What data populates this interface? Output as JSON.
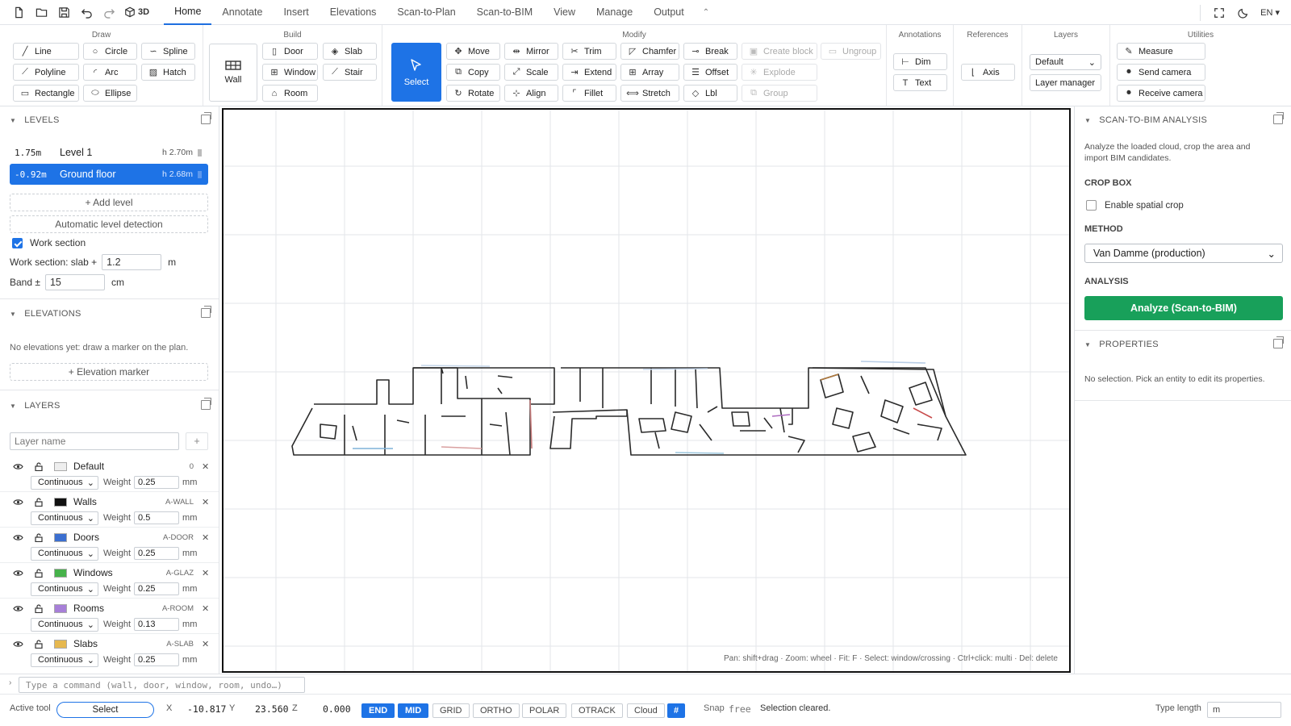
{
  "toolbar": {
    "three_d_label": "3D",
    "tabs": [
      "Home",
      "Annotate",
      "Insert",
      "Elevations",
      "Scan-to-Plan",
      "Scan-to-BIM",
      "View",
      "Manage",
      "Output"
    ],
    "active_tab": "Home",
    "lang": "EN"
  },
  "ribbon": {
    "draw": {
      "title": "Draw",
      "items": [
        "Line",
        "Circle",
        "Spline",
        "Polyline",
        "Arc",
        "Hatch",
        "Rectangle",
        "Ellipse"
      ]
    },
    "build": {
      "title": "Build",
      "wall": "Wall",
      "items": [
        "Door",
        "Slab",
        "Window",
        "Stair",
        "Room"
      ]
    },
    "modify": {
      "title": "Modify",
      "select": "Select",
      "items": [
        "Move",
        "Mirror",
        "Trim",
        "Chamfer",
        "Break",
        "Create block",
        "Ungroup",
        "Copy",
        "Scale",
        "Extend",
        "Array",
        "Offset",
        "Explode",
        "Rotate",
        "Align",
        "Fillet",
        "Stretch",
        "Lbl",
        "Group"
      ]
    },
    "annotations": {
      "title": "Annotations",
      "items": [
        "Dim",
        "Text"
      ]
    },
    "references": {
      "title": "References",
      "items": [
        "Axis"
      ]
    },
    "layers": {
      "title": "Layers",
      "current": "Default",
      "manager": "Layer manager"
    },
    "utilities": {
      "title": "Utilities",
      "items": [
        "Measure",
        "Send camera",
        "Receive camera"
      ]
    }
  },
  "levels": {
    "title": "LEVELS",
    "items": [
      {
        "elev": "1.75m",
        "name": "Level 1",
        "h": "h 2.70m"
      },
      {
        "elev": "-0.92m",
        "name": "Ground floor",
        "h": "h 2.68m"
      }
    ],
    "add": "+ Add level",
    "auto": "Automatic level detection",
    "work_section_label": "Work section",
    "slab_label": "Work section: slab +",
    "slab_value": "1.2",
    "slab_unit": "m",
    "band_label": "Band ±",
    "band_value": "15",
    "band_unit": "cm"
  },
  "elevations": {
    "title": "ELEVATIONS",
    "empty": "No elevations yet: draw a marker on the plan.",
    "add": "+ Elevation marker"
  },
  "layers": {
    "title": "LAYERS",
    "placeholder": "Layer name",
    "add": "+",
    "weight_label": "Weight",
    "unit": "mm",
    "items": [
      {
        "name": "Default",
        "code": "0",
        "type": "Continuous",
        "weight": "0.25",
        "color": "#eeeeee"
      },
      {
        "name": "Walls",
        "code": "A-WALL",
        "type": "Continuous",
        "weight": "0.5",
        "color": "#111111"
      },
      {
        "name": "Doors",
        "code": "A-DOOR",
        "type": "Continuous",
        "weight": "0.25",
        "color": "#3b6fd0"
      },
      {
        "name": "Windows",
        "code": "A-GLAZ",
        "type": "Continuous",
        "weight": "0.25",
        "color": "#46b24a"
      },
      {
        "name": "Rooms",
        "code": "A-ROOM",
        "type": "Continuous",
        "weight": "0.13",
        "color": "#a77fd8"
      },
      {
        "name": "Slabs",
        "code": "A-SLAB",
        "type": "Continuous",
        "weight": "0.25",
        "color": "#e6b84f"
      }
    ]
  },
  "canvas": {
    "hint": "Pan: shift+drag · Zoom: wheel · Fit: F · Select: window/crossing · Ctrl+click: multi · Del: delete"
  },
  "scan": {
    "title": "SCAN-TO-BIM ANALYSIS",
    "desc": "Analyze the loaded cloud, crop the area and import BIM candidates.",
    "crop_label": "CROP BOX",
    "crop_check": "Enable spatial crop",
    "method_label": "METHOD",
    "method_value": "Van Damme (production)",
    "analysis_label": "ANALYSIS",
    "analyze": "Analyze (Scan-to-BIM)"
  },
  "properties": {
    "title": "PROPERTIES",
    "empty": "No selection. Pick an entity to edit its properties."
  },
  "command": {
    "prompt": "›",
    "placeholder": "Type a command (wall, door, window, room, undo…)"
  },
  "status": {
    "active_tool_label": "Active tool",
    "active_tool": "Select",
    "x_label": "X",
    "x": "-10.817",
    "y_label": "Y",
    "y": "23.560",
    "z_label": "Z",
    "z": "0.000",
    "snaps": [
      {
        "label": "END",
        "on": true
      },
      {
        "label": "MID",
        "on": true
      },
      {
        "label": "GRID",
        "on": false
      },
      {
        "label": "ORTHO",
        "on": false
      },
      {
        "label": "POLAR",
        "on": false
      },
      {
        "label": "OTRACK",
        "on": false
      },
      {
        "label": "Cloud",
        "on": false
      }
    ],
    "snap_label": "Snap",
    "snap_value": "free",
    "message": "Selection cleared.",
    "length_label": "Type length",
    "length_placeholder": "m"
  },
  "colors": {
    "accent": "#1e73e6",
    "green": "#18a05a"
  }
}
